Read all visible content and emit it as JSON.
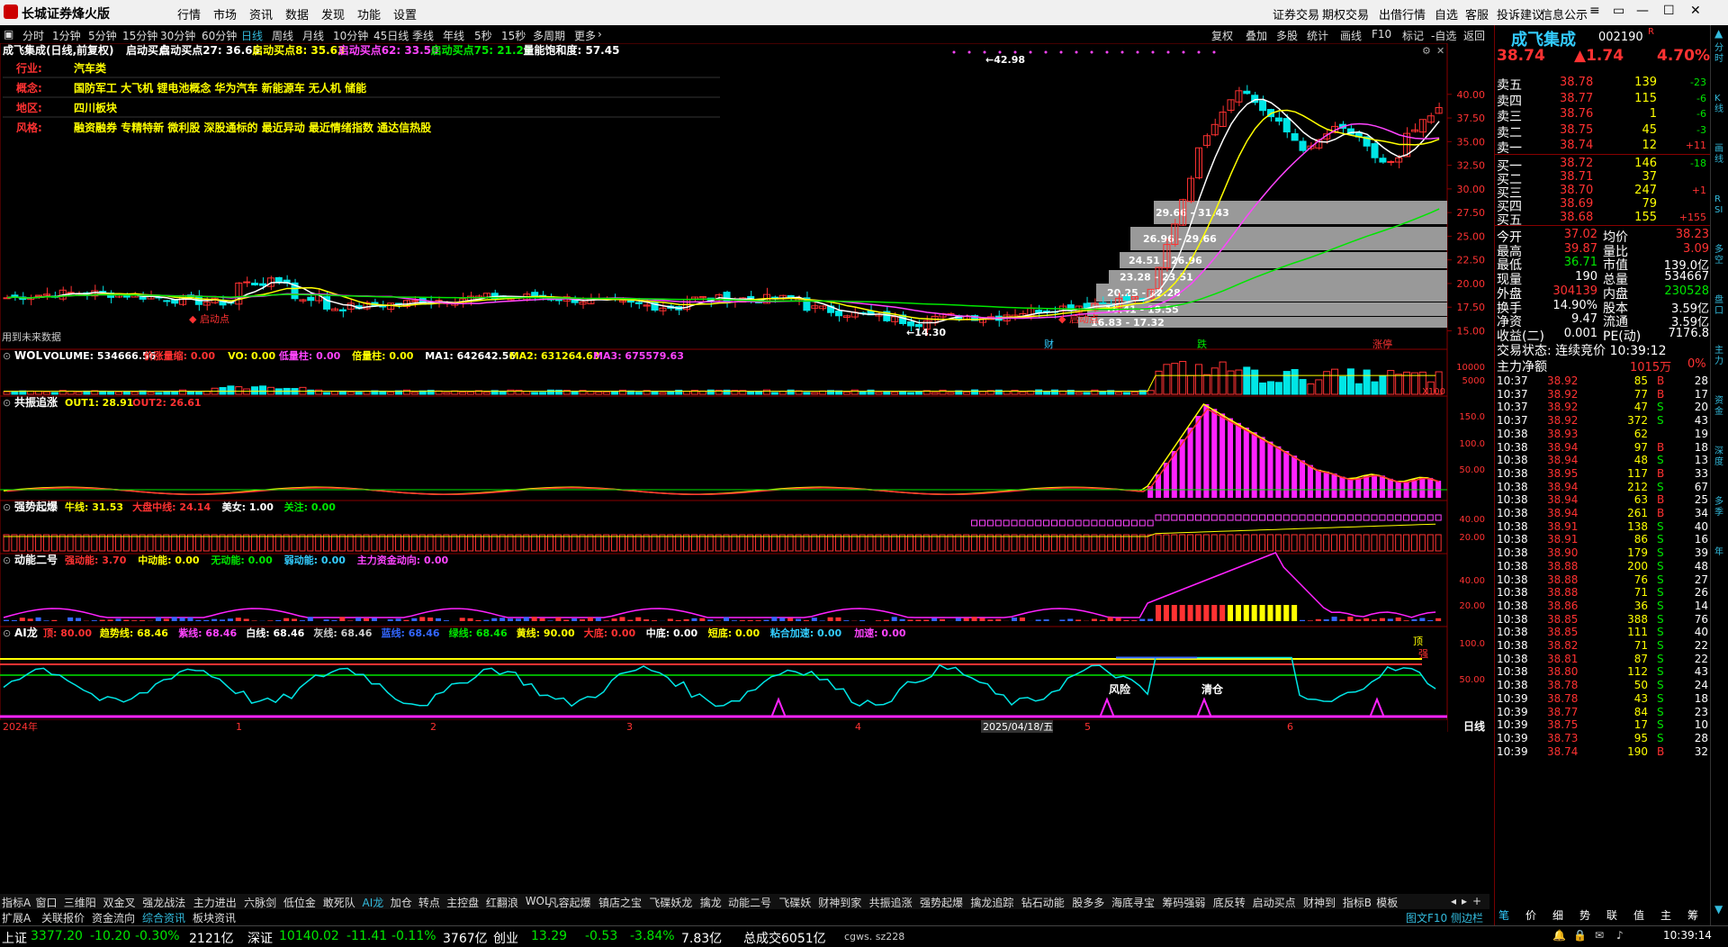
{
  "app": {
    "title": "长城证券烽火版",
    "menus": [
      "行情",
      "市场",
      "资讯",
      "数据",
      "发现",
      "功能",
      "设置"
    ],
    "right_menus": [
      "证券交易",
      "期权交易",
      "出借行情",
      "自选",
      "客服",
      "投诉建议",
      "信息公示"
    ]
  },
  "periods": [
    "分时",
    "1分钟",
    "5分钟",
    "15分钟",
    "30分钟",
    "60分钟",
    "日线",
    "周线",
    "月线",
    "10分钟",
    "45日线",
    "季线",
    "年线",
    "5秒",
    "15秒",
    "多周期",
    "更多"
  ],
  "active_period": "日线",
  "tools": [
    "复权",
    "叠加",
    "多股",
    "统计",
    "画线",
    "F10",
    "标记",
    "-自选",
    "返回"
  ],
  "stock_header": {
    "name_line": "成飞集成(日线,前复权)",
    "indicators": [
      {
        "text": "启动买点",
        "color": "#ffffff"
      },
      {
        "text": "启动买点27: 36.65",
        "color": "#ffffff"
      },
      {
        "text": "启动买点8: 35.63",
        "color": "#ffff00"
      },
      {
        "text": "启动买点62: 33.50",
        "color": "#ff44ff"
      },
      {
        "text": "启动买点75: 21.29",
        "color": "#00e600"
      },
      {
        "text": "量能饱和度: 57.45",
        "color": "#ffffff"
      }
    ]
  },
  "info": {
    "industry_label": "行业:",
    "industry": "汽车类",
    "concept_label": "概念:",
    "concept": "国防军工 大飞机 锂电池概念 华为汽车 新能源车 无人机 储能",
    "region_label": "地区:",
    "region": "四川板块",
    "style_label": "风格:",
    "style": "融资融券 专精特新 微利股 深股通标的 最近异动 最近情绪指数 通达信热股"
  },
  "main_chart": {
    "high_label": "42.98",
    "low_label": "14.30",
    "future_note": "用到未来数据",
    "y_ticks": [
      "40.00",
      "37.50",
      "35.00",
      "32.50",
      "30.00",
      "27.50",
      "25.00",
      "22.50",
      "20.00",
      "17.50",
      "15.00"
    ],
    "zones": [
      "29.66 - 31.43",
      "26.96 - 29.66",
      "24.51 - 26.96",
      "23.28 - 23.51",
      "20.25 - 22.28",
      "18.41 - 19.55",
      "16.83 - 17.32"
    ],
    "markers": [
      "启动点",
      "启动点"
    ],
    "events": [
      "财",
      "跌",
      "涨停"
    ]
  },
  "panels": [
    {
      "id": "vol",
      "title": "WOL",
      "items": [
        {
          "text": "VOLUME: 534666.56",
          "color": "#ffffff"
        },
        {
          "text": "价涨量缩: 0.00",
          "color": "#ff3232"
        },
        {
          "text": "VO: 0.00",
          "color": "#ffff00"
        },
        {
          "text": "低量柱: 0.00",
          "color": "#ff44ff"
        },
        {
          "text": "倍量柱: 0.00",
          "color": "#ffff00"
        },
        {
          "text": "MA1: 642642.56",
          "color": "#ffffff"
        },
        {
          "text": "MA2: 631264.63",
          "color": "#ffff00"
        },
        {
          "text": "MA3: 675579.63",
          "color": "#ff44ff"
        }
      ],
      "ticks": [
        "10000",
        "5000",
        "X100"
      ]
    },
    {
      "id": "gz",
      "title": "共振追涨",
      "items": [
        {
          "text": "OUT1: 28.91",
          "color": "#ffff00"
        },
        {
          "text": "OUT2: 26.61",
          "color": "#ff3232"
        }
      ],
      "ticks": [
        "150.0",
        "100.0",
        "50.00"
      ]
    },
    {
      "id": "qs",
      "title": "强势起爆",
      "items": [
        {
          "text": "牛线: 31.53",
          "color": "#ffff00"
        },
        {
          "text": "大盘中线: 24.14",
          "color": "#ff3232"
        },
        {
          "text": "美女: 1.00",
          "color": "#ffffff"
        },
        {
          "text": "关注: 0.00",
          "color": "#00e600"
        }
      ],
      "ticks": [
        "40.00",
        "20.00"
      ]
    },
    {
      "id": "dn",
      "title": "动能二号",
      "items": [
        {
          "text": "强动能: 3.70",
          "color": "#ff3232"
        },
        {
          "text": "中动能: 0.00",
          "color": "#ffff00"
        },
        {
          "text": "无动能: 0.00",
          "color": "#00e600"
        },
        {
          "text": "弱动能: 0.00",
          "color": "#3cf"
        },
        {
          "text": "主力资金动向: 0.00",
          "color": "#ff44ff"
        }
      ],
      "ticks": [
        "40.00",
        "20.00"
      ]
    },
    {
      "id": "ai",
      "title": "AI龙",
      "items": [
        {
          "text": "顶: 80.00",
          "color": "#ff3232"
        },
        {
          "text": "趋势线: 68.46",
          "color": "#ffff00"
        },
        {
          "text": "紫线: 68.46",
          "color": "#ff44ff"
        },
        {
          "text": "白线: 68.46",
          "color": "#ffffff"
        },
        {
          "text": "灰线: 68.46",
          "color": "#cccccc"
        },
        {
          "text": "蓝线: 68.46",
          "color": "#3366ff"
        },
        {
          "text": "绿线: 68.46",
          "color": "#00e600"
        },
        {
          "text": "黄线: 90.00",
          "color": "#ffff00"
        },
        {
          "text": "大底: 0.00",
          "color": "#ff3232"
        },
        {
          "text": "中底: 0.00",
          "color": "#ffffff"
        },
        {
          "text": "短底: 0.00",
          "color": "#ffff00"
        },
        {
          "text": "粘合加速: 0.00",
          "color": "#3cf"
        },
        {
          "text": "加速: 0.00",
          "color": "#ff44ff"
        }
      ],
      "ticks": [
        "100.0",
        "50.00"
      ],
      "labels": [
        "风险",
        "清仓",
        "顶",
        "强"
      ]
    }
  ],
  "x_axis": {
    "labels": [
      "2024年",
      "1",
      "2",
      "3",
      "4",
      "5",
      "6"
    ],
    "cursor_date": "2025/04/18/五",
    "period": "日线"
  },
  "tabs1": [
    "指标A",
    "窗口",
    "三维阳",
    "双金叉",
    "强龙战法",
    "主力进出",
    "六脉剑",
    "低位金",
    "敢死队",
    "AI龙",
    "加仓",
    "转点",
    "主控盘",
    "红翻浪",
    "WOL",
    "凡容起爆",
    "镇店之宝",
    "飞碟妖龙",
    "擒龙",
    "动能二号",
    "飞碟妖",
    "财神到家",
    "共振追涨",
    "强势起爆",
    "擒龙追踪",
    "钻石动能",
    "股多多",
    "海底寻宝",
    "筹码强弱",
    "底反转",
    "启动买点",
    "财神到",
    "指标B",
    "模板"
  ],
  "tabs1_active": "AI龙",
  "tabs2": [
    "扩展A",
    "关联报价",
    "资金流向",
    "综合资讯",
    "板块资讯"
  ],
  "tabs2_right": [
    "图文F10",
    "侧边栏"
  ],
  "status": {
    "sh_label": "上证",
    "sh_val": "3377.20",
    "sh_chg": "-10.20",
    "sh_pct": "-0.30%",
    "sh_amt": "2121亿",
    "sz_label": "深证",
    "sz_val": "10140.02",
    "sz_chg": "-11.41",
    "sz_pct": "-0.11%",
    "sz_amt": "3767亿",
    "cy_label": "创业",
    "cy_val": "13.29",
    "cy_chg": "-0.53",
    "cy_pct": "-3.84%",
    "cy_amt": "7.83亿",
    "total": "总成交6051亿",
    "server": "cgws. sz228",
    "time": "10:39:14"
  },
  "quote": {
    "name": "成飞集成",
    "code": "002190",
    "badge": "R",
    "price": "38.74",
    "change": "▲1.74",
    "pct": "4.70%",
    "asks": [
      [
        "卖五",
        "38.78",
        "139",
        "-23"
      ],
      [
        "卖四",
        "38.77",
        "115",
        "-6"
      ],
      [
        "卖三",
        "38.76",
        "1",
        "-6"
      ],
      [
        "卖二",
        "38.75",
        "45",
        "-3"
      ],
      [
        "卖一",
        "38.74",
        "12",
        "+11"
      ]
    ],
    "bids": [
      [
        "买一",
        "38.72",
        "146",
        "-18"
      ],
      [
        "买二",
        "38.71",
        "37",
        ""
      ],
      [
        "买三",
        "38.70",
        "247",
        "+1"
      ],
      [
        "买四",
        "38.69",
        "79",
        ""
      ],
      [
        "买五",
        "38.68",
        "155",
        "+155"
      ]
    ],
    "stats": [
      [
        "今开",
        "37.02",
        "均价",
        "38.23"
      ],
      [
        "最高",
        "39.87",
        "量比",
        "3.09"
      ],
      [
        "最低",
        "36.71",
        "市值",
        "139.0亿"
      ],
      [
        "现量",
        "190",
        "总量",
        "534667"
      ],
      [
        "外盘",
        "304139",
        "内盘",
        "230528"
      ],
      [
        "换手",
        "14.90%",
        "股本",
        "3.59亿"
      ],
      [
        "净资",
        "9.47",
        "流通",
        "3.59亿"
      ],
      [
        "收益(二)",
        "0.001",
        "PE(动)",
        "7176.8"
      ]
    ],
    "trade_state": "交易状态: 连续竞价 10:39:12",
    "main_net_label": "主力净额",
    "main_net_val": "1015万",
    "main_net_pct": "0%",
    "ticks": [
      [
        "10:37",
        "38.92",
        "85",
        "B",
        "28"
      ],
      [
        "10:37",
        "38.92",
        "77",
        "B",
        "17"
      ],
      [
        "10:37",
        "38.92",
        "47",
        "S",
        "20"
      ],
      [
        "10:37",
        "38.92",
        "372",
        "S",
        "43"
      ],
      [
        "10:38",
        "38.93",
        "62",
        "",
        "19"
      ],
      [
        "10:38",
        "38.94",
        "97",
        "B",
        "18"
      ],
      [
        "10:38",
        "38.94",
        "48",
        "S",
        "13"
      ],
      [
        "10:38",
        "38.95",
        "117",
        "B",
        "33"
      ],
      [
        "10:38",
        "38.94",
        "212",
        "S",
        "67"
      ],
      [
        "10:38",
        "38.94",
        "63",
        "B",
        "25"
      ],
      [
        "10:38",
        "38.94",
        "261",
        "B",
        "34"
      ],
      [
        "10:38",
        "38.91",
        "138",
        "S",
        "40"
      ],
      [
        "10:38",
        "38.91",
        "86",
        "S",
        "16"
      ],
      [
        "10:38",
        "38.90",
        "179",
        "S",
        "39"
      ],
      [
        "10:38",
        "38.88",
        "200",
        "S",
        "48"
      ],
      [
        "10:38",
        "38.88",
        "76",
        "S",
        "27"
      ],
      [
        "10:38",
        "38.88",
        "71",
        "S",
        "26"
      ],
      [
        "10:38",
        "38.86",
        "36",
        "S",
        "14"
      ],
      [
        "10:38",
        "38.85",
        "388",
        "S",
        "76"
      ],
      [
        "10:38",
        "38.85",
        "111",
        "S",
        "40"
      ],
      [
        "10:38",
        "38.82",
        "71",
        "S",
        "22"
      ],
      [
        "10:38",
        "38.81",
        "87",
        "S",
        "22"
      ],
      [
        "10:38",
        "38.80",
        "112",
        "S",
        "43"
      ],
      [
        "10:38",
        "38.78",
        "50",
        "S",
        "24"
      ],
      [
        "10:39",
        "38.78",
        "43",
        "S",
        "18"
      ],
      [
        "10:39",
        "38.77",
        "84",
        "S",
        "23"
      ],
      [
        "10:39",
        "38.75",
        "17",
        "S",
        "10"
      ],
      [
        "10:39",
        "38.73",
        "95",
        "S",
        "28"
      ],
      [
        "10:39",
        "38.74",
        "190",
        "B",
        "32"
      ]
    ],
    "bottom_tabs": [
      "笔",
      "价",
      "细",
      "势",
      "联",
      "值",
      "主",
      "筹"
    ]
  },
  "side_tabs": [
    "分时",
    "K线",
    "画线",
    "RSI",
    "多空",
    "盘口",
    "主力",
    "资金",
    "深度",
    "多季",
    "年"
  ],
  "colors": {
    "up": "#ff3232",
    "down": "#00e6e6",
    "ma5": "#ffffff",
    "ma10": "#ffff00",
    "ma20": "#ff44ff",
    "ma60": "#00e600",
    "accent": "#3bd"
  }
}
